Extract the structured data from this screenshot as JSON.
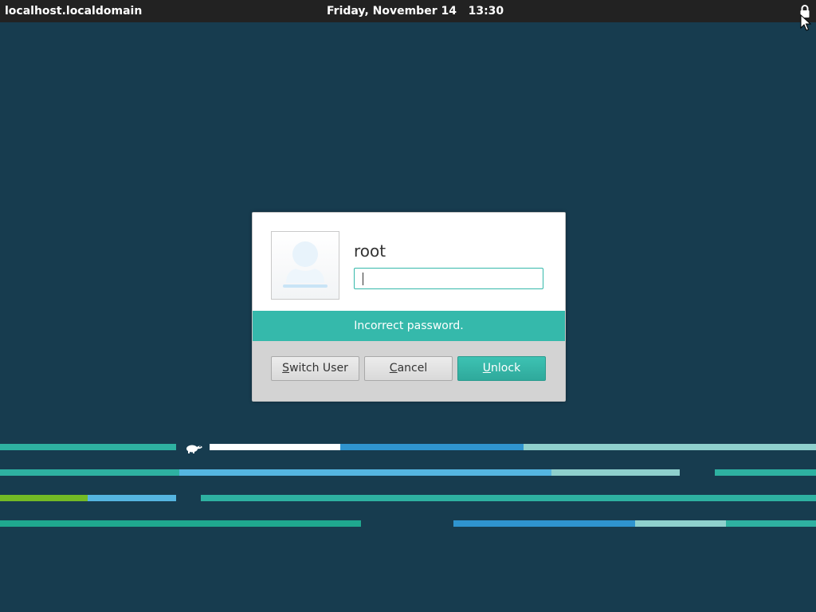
{
  "top_panel": {
    "hostname": "localhost.localdomain",
    "date": "Friday, November 14",
    "time": "13:30"
  },
  "dialog": {
    "username": "root",
    "password_value": "",
    "error_message": "Incorrect password.",
    "buttons": {
      "switch_user": {
        "mnemonic": "S",
        "rest": "witch User"
      },
      "cancel": {
        "mnemonic": "C",
        "rest": "ancel"
      },
      "unlock": {
        "mnemonic": "U",
        "rest": "nlock"
      }
    }
  },
  "icons": {
    "panel_lock": "lock-icon",
    "pointer": "mouse-cursor-icon",
    "avatar": "user-avatar-icon",
    "brand": "opensuse-gecko-icon"
  },
  "colors": {
    "background": "#173c4f",
    "panel": "#222222",
    "accent": "#35b9ab",
    "stripe_teal": "#2eb1a1",
    "stripe_blue": "#2f94cf",
    "stripe_lightblue": "#55b5e0",
    "stripe_pale": "#8fd0cd",
    "stripe_green": "#73ba25",
    "stripe_white": "#ffffff"
  }
}
